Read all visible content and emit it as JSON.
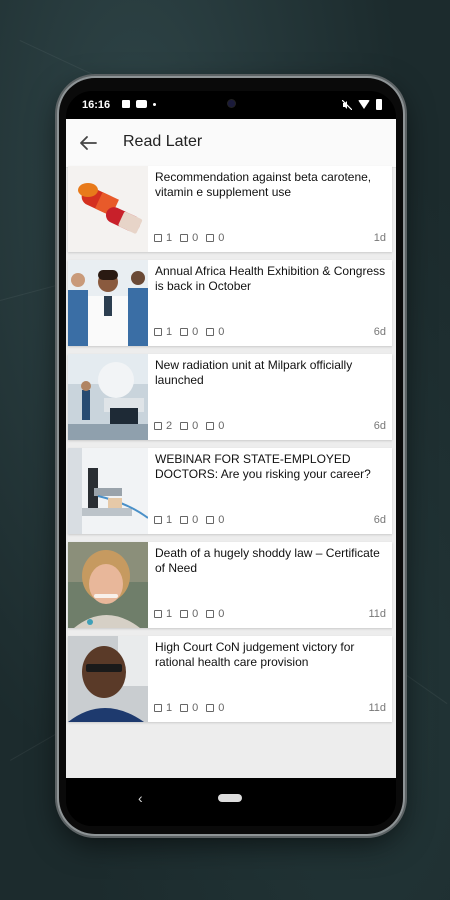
{
  "status_bar": {
    "time": "16:16"
  },
  "header": {
    "title": "Read Later",
    "back_icon": "arrow-left-icon"
  },
  "articles": [
    {
      "title": "Recommendation against beta carotene, vitamin e supplement use",
      "images": "1",
      "comments": "0",
      "saves": "0",
      "age": "1d",
      "thumb": "capsules-photo"
    },
    {
      "title": "Annual Africa Health Exhibition & Congress is back in October",
      "images": "1",
      "comments": "0",
      "saves": "0",
      "age": "6d",
      "thumb": "medical-staff-photo"
    },
    {
      "title": "New radiation unit at Milpark officially launched",
      "images": "2",
      "comments": "0",
      "saves": "0",
      "age": "6d",
      "thumb": "radiation-machine-photo"
    },
    {
      "title": "WEBINAR FOR STATE-EMPLOYED DOCTORS: Are you risking your career?",
      "images": "1",
      "comments": "0",
      "saves": "0",
      "age": "6d",
      "thumb": "microscope-photo"
    },
    {
      "title": "Death of a hugely shoddy law – Certificate of Need",
      "images": "1",
      "comments": "0",
      "saves": "0",
      "age": "11d",
      "thumb": "woman-portrait-photo"
    },
    {
      "title": "High Court CoN judgement victory for rational health care provision",
      "images": "1",
      "comments": "0",
      "saves": "0",
      "age": "11d",
      "thumb": "man-portrait-photo"
    }
  ],
  "colors": {
    "background": "#1c2b2d",
    "app_background": "#ededed",
    "card": "#ffffff",
    "text": "#111111",
    "meta": "#666666"
  }
}
